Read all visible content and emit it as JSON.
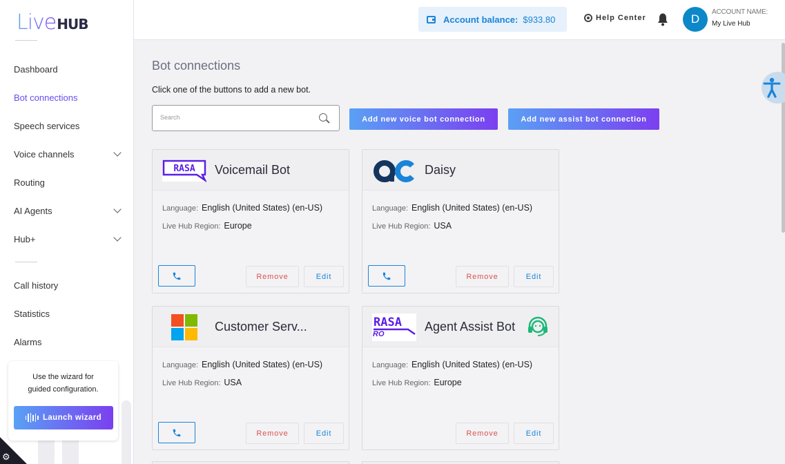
{
  "brand": {
    "logo_live": "Live",
    "logo_hub": "HUB"
  },
  "colors": {
    "accent_start": "#5aa0f5",
    "accent_end": "#7b3ff0",
    "active_nav": "#6b4cf0",
    "link_blue": "#1a84d8",
    "remove_red": "#d9534f",
    "avatar_bg": "#0c88c9"
  },
  "sidebar": {
    "items": [
      {
        "label": "Dashboard"
      },
      {
        "label": "Bot connections",
        "active": true
      },
      {
        "label": "Speech services"
      },
      {
        "label": "Voice channels",
        "expandable": true
      },
      {
        "label": "Routing"
      },
      {
        "label": "AI Agents",
        "expandable": true
      },
      {
        "label": "Hub+",
        "expandable": true
      },
      {
        "label": "Call history"
      },
      {
        "label": "Statistics"
      },
      {
        "label": "Alarms"
      }
    ],
    "wizard": {
      "text": "Use the wizard for guided configuration.",
      "button_label": "Launch wizard",
      "icon": "waveform-icon"
    },
    "settings_icon": "gear-icon"
  },
  "header": {
    "balance_label": "Account balance:",
    "balance_value": "$933.80",
    "help_label": "Help Center",
    "account_label": "ACCOUNT NAME:",
    "account_name": "My Live Hub",
    "avatar_letter": "D"
  },
  "main": {
    "title": "Bot connections",
    "subtitle": "Click one of the buttons to add a new bot.",
    "search_placeholder": "Search",
    "search_value": "",
    "add_voice_label": "Add new voice bot connection",
    "add_assist_label": "Add new assist bot connection",
    "language_label": "Language:",
    "region_label": "Live Hub Region:",
    "remove_label": "Remove",
    "edit_label": "Edit",
    "cards": [
      {
        "title": "Voicemail Bot",
        "logo": "rasa-logo",
        "language": "English (United States) (en-US)",
        "region": "Europe"
      },
      {
        "title": "Daisy",
        "logo": "ac-logo",
        "language": "English (United States) (en-US)",
        "region": "USA"
      },
      {
        "title": "Customer Serv...",
        "logo": "microsoft-logo",
        "language": "English (United States) (en-US)",
        "region": "USA"
      },
      {
        "title": "Agent Assist Bot",
        "logo": "rasa-ro-logo",
        "logo_text": "RO",
        "language": "English (United States) (en-US)",
        "region": "Europe",
        "badge_icon": "agent-assist-icon"
      }
    ]
  }
}
